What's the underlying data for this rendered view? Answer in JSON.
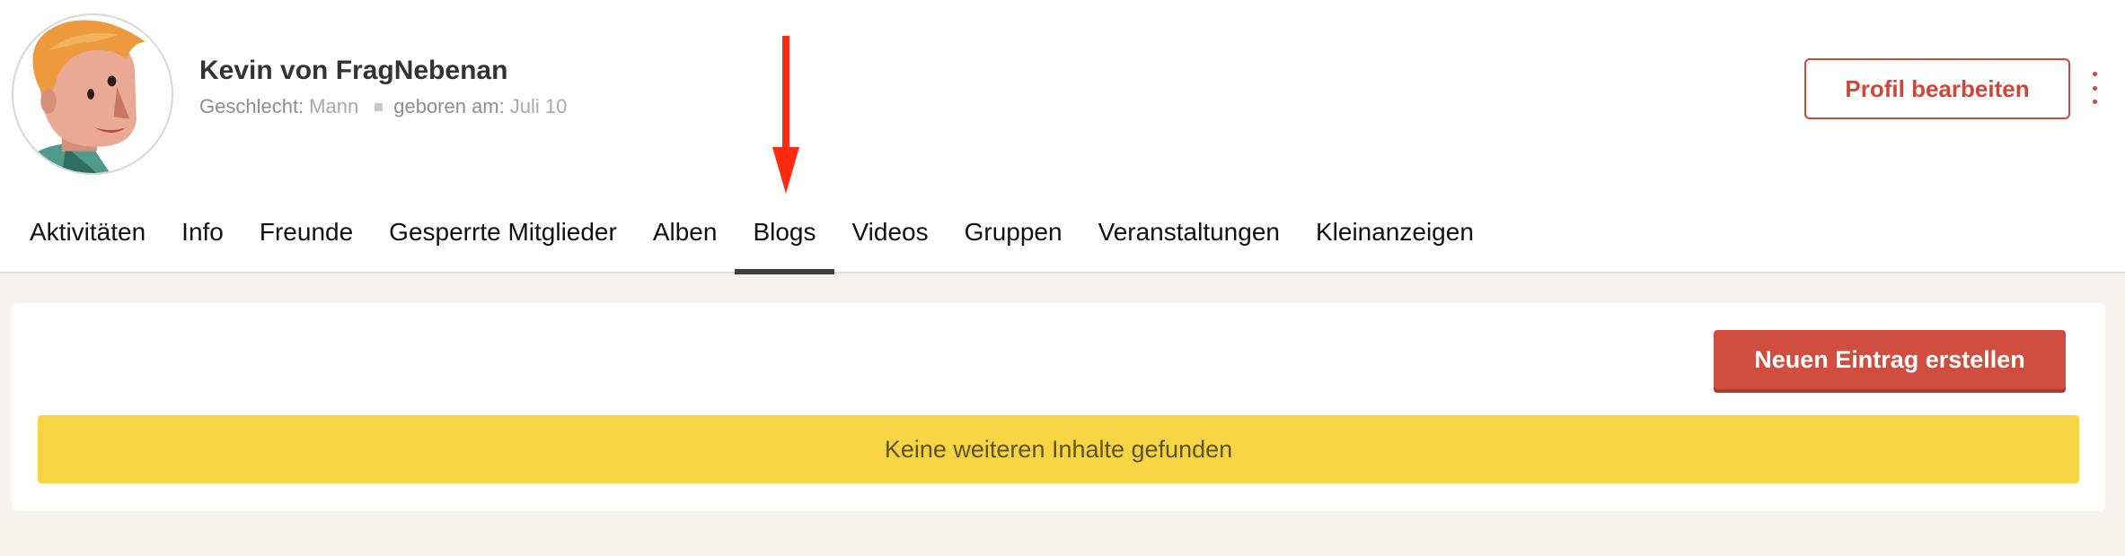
{
  "profile": {
    "name": "Kevin von FragNebenan",
    "gender_label": "Geschlecht:",
    "gender_value": "Mann",
    "birth_label": "geboren am:",
    "birth_value": "Juli 10",
    "edit_button_label": "Profil bearbeiten",
    "more_icon": "vertical-ellipsis-icon"
  },
  "tabs": [
    {
      "label": "Aktivitäten",
      "active": false
    },
    {
      "label": "Info",
      "active": false
    },
    {
      "label": "Freunde",
      "active": false
    },
    {
      "label": "Gesperrte Mitglieder",
      "active": false
    },
    {
      "label": "Alben",
      "active": false
    },
    {
      "label": "Blogs",
      "active": true
    },
    {
      "label": "Videos",
      "active": false
    },
    {
      "label": "Gruppen",
      "active": false
    },
    {
      "label": "Veranstaltungen",
      "active": false
    },
    {
      "label": "Kleinanzeigen",
      "active": false
    }
  ],
  "content": {
    "new_entry_button_label": "Neuen Eintrag erstellen",
    "notice_text": "Keine weiteren Inhalte gefunden"
  },
  "colors": {
    "accent": "#d0473a",
    "button_fill": "#cf4e40",
    "notice_bg": "#f7d443",
    "annotation_arrow": "#ff2a10",
    "page_bg": "#f6f3ee"
  }
}
